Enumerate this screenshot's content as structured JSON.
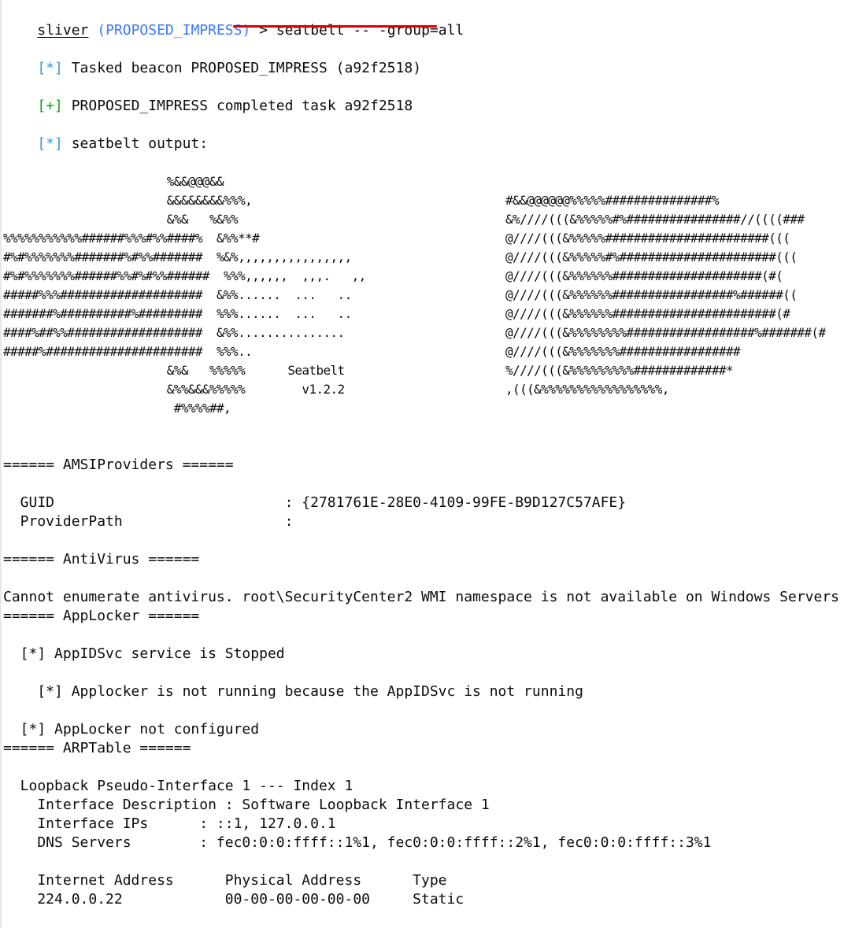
{
  "colors": {
    "prompt_name": "#3b78ff",
    "info_bracket": "#3a96dd",
    "success_bracket": "#13a10e",
    "red_underline": "#e00000",
    "text": "#0c0c0c",
    "background": "#ffffff"
  },
  "prompt": {
    "app": "sliver",
    "session": "(PROPOSED_IMPRESS)",
    "arrow": ">",
    "command": "seatbelt -- -group=all"
  },
  "messages": {
    "tasked_marker": "[*]",
    "tasked_text": " Tasked beacon PROPOSED_IMPRESS (a92f2518)",
    "completed_marker": "[+]",
    "completed_text": " PROPOSED_IMPRESS completed task a92f2518",
    "output_marker": "[*]",
    "output_text": " seatbelt output:"
  },
  "banner": {
    "left": [
      "                       %&&@@@&&",
      "                       &&&&&&&&%%%,",
      "                       &%&   %&%%",
      "%%%%%%%%%%%######%%%#%%####%  &%%**#",
      "#%#%%%%%%%#######%#%%#######  %&%,,,,,,,,,,,,,,,,",
      "#%#%%%%%%%######%%#%#%%######  %%%,,,,,,  ,,,.   ,,",
      "#####%%%####################  &%%......  ...   ..",
      "#######%##########%#########  %%%......  ...   ..",
      "####%##%%###################  &%%...............",
      "#####%######################  %%%..",
      "                       &%&   %%%%%      Seatbelt",
      "                       &%%&&&%%%%%        v1.2.2",
      "                        #%%%%##,"
    ],
    "right": [
      "#&&@@@@@@%%%%%###############%",
      "&%////(((&%%%%%#%################//((((###",
      "@////(((&%%%%%#######################(((",
      "@////(((&%%%%%#%######################(((",
      "@////(((&%%%%%%#####################(#(",
      "@////(((&%%%%%%#################%######((",
      "@////(((&%%%%%%#######################(#",
      "@////(((&%%%%%%%%##################%#######(#",
      "@////(((&%%%%%%%#################",
      "%////(((&%%%%%%%%%#############*",
      ",(((&%%%%%%%%%%%%%%%%%,"
    ]
  },
  "sections": {
    "amsi_header": "====== AMSIProviders ======",
    "amsi_guid_label": "  GUID                           : {2781761E-28E0-4109-99FE-B9D127C57AFE}",
    "amsi_path_label": "  ProviderPath                   :",
    "antivirus_header": "====== AntiVirus ======",
    "antivirus_msg": "Cannot enumerate antivirus. root\\SecurityCenter2 WMI namespace is not available on Windows Servers",
    "applocker_header": "====== AppLocker ======",
    "applocker_1": "  [*] AppIDSvc service is Stopped",
    "applocker_2": "    [*] Applocker is not running because the AppIDSvc is not running",
    "applocker_3": "  [*] AppLocker not configured",
    "arp_header": "====== ARPTable ======",
    "arp_iface": "  Loopback Pseudo-Interface 1 --- Index 1",
    "arp_desc": "    Interface Description : Software Loopback Interface 1",
    "arp_ips": "    Interface IPs      : ::1, 127.0.0.1",
    "arp_dns": "    DNS Servers        : fec0:0:0:ffff::1%1, fec0:0:0:ffff::2%1, fec0:0:0:ffff::3%1",
    "arp_table_header": "    Internet Address      Physical Address      Type",
    "arp_table_row": "    224.0.0.22            00-00-00-00-00-00     Static"
  }
}
